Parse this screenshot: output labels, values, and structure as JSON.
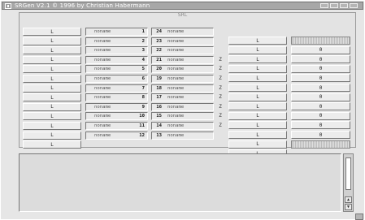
{
  "window": {
    "title": "SRGen V2.1  © 1996 by Christian Habermann"
  },
  "panel": {
    "title": "SRL"
  },
  "left_buttons": [
    "L",
    "L",
    "L",
    "L",
    "L",
    "L",
    "L",
    "L",
    "L",
    "L",
    "L",
    "L",
    "L"
  ],
  "left_fields": [
    {
      "name": "noname",
      "num": "1"
    },
    {
      "name": "noname",
      "num": "2"
    },
    {
      "name": "noname",
      "num": "3"
    },
    {
      "name": "noname",
      "num": "4"
    },
    {
      "name": "noname",
      "num": "5"
    },
    {
      "name": "noname",
      "num": "6"
    },
    {
      "name": "noname",
      "num": "7"
    },
    {
      "name": "noname",
      "num": "8"
    },
    {
      "name": "noname",
      "num": "9"
    },
    {
      "name": "noname",
      "num": "10"
    },
    {
      "name": "noname",
      "num": "11"
    },
    {
      "name": "noname",
      "num": "12"
    }
  ],
  "right_fields": [
    {
      "num": "24",
      "name": "noname"
    },
    {
      "num": "23",
      "name": "noname"
    },
    {
      "num": "22",
      "name": "noname"
    },
    {
      "num": "21",
      "name": "noname"
    },
    {
      "num": "20",
      "name": "noname"
    },
    {
      "num": "19",
      "name": "noname"
    },
    {
      "num": "18",
      "name": "noname"
    },
    {
      "num": "17",
      "name": "noname"
    },
    {
      "num": "16",
      "name": "noname"
    },
    {
      "num": "15",
      "name": "noname"
    },
    {
      "num": "14",
      "name": "noname"
    },
    {
      "num": "13",
      "name": "noname"
    }
  ],
  "z_labels": [
    "",
    "",
    "Z",
    "Z",
    "Z",
    "Z",
    "Z",
    "Z",
    "Z",
    "Z",
    "",
    ""
  ],
  "mid_buttons": [
    "L",
    "L",
    "L",
    "L",
    "L",
    "L",
    "L",
    "L",
    "L",
    "L",
    "L",
    "L",
    "L"
  ],
  "right_buttons": [
    "0",
    "0",
    "0",
    "0",
    "0",
    "0",
    "0",
    "0",
    "0",
    "0"
  ],
  "textarea": {
    "value": ""
  }
}
